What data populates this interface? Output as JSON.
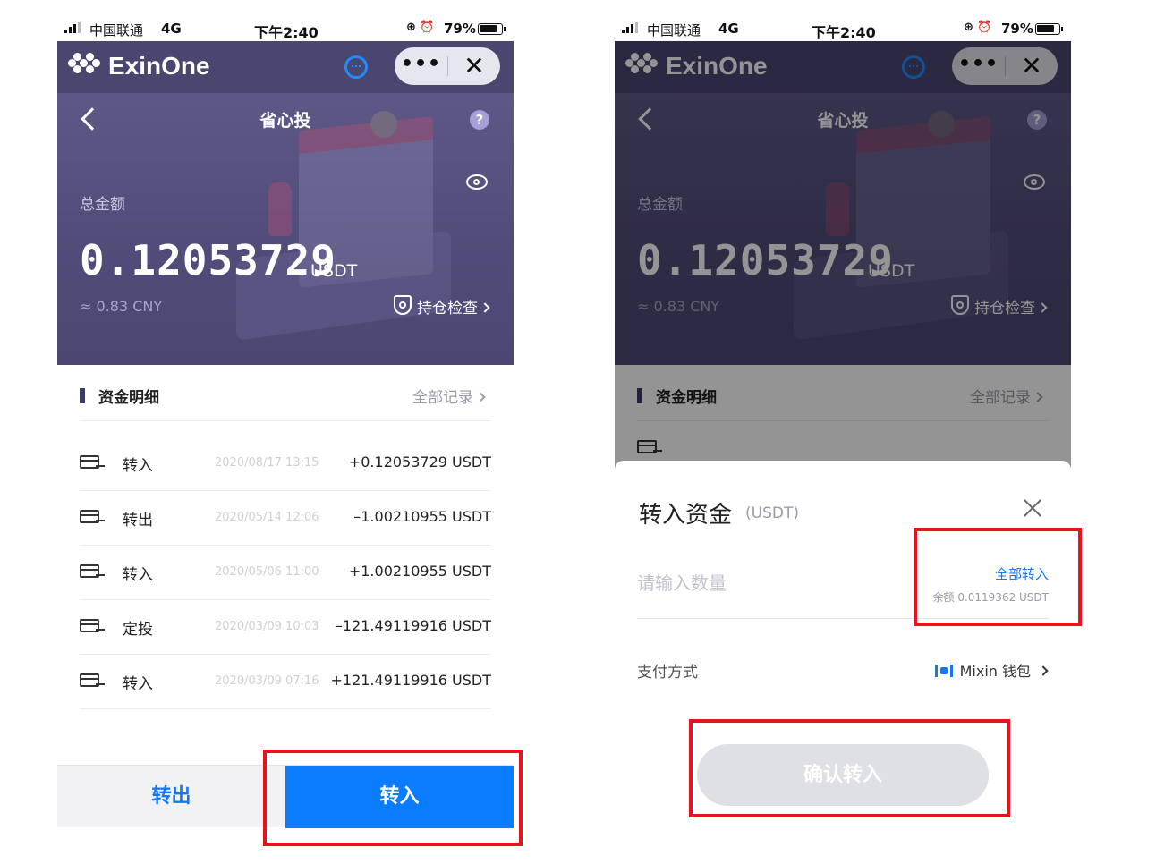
{
  "status": {
    "carrier": "中国联通",
    "network": "4G",
    "time": "下午2:40",
    "battery": "79%",
    "battery_level": 0.79
  },
  "app": {
    "brand": "ExinOne",
    "more_label": "•••",
    "close_label": "✕"
  },
  "page": {
    "title": "省心投",
    "help_label": "?",
    "total_label": "总金额",
    "total_value": "0.12053729",
    "total_unit": "USDT",
    "cny_value": "≈ 0.83 CNY",
    "check_label": "持仓检查"
  },
  "details": {
    "title": "资金明细",
    "all_records": "全部记录",
    "rows": [
      {
        "type": "转入",
        "date": "2020/08/17 13:15",
        "amount": "+0.12053729 USDT"
      },
      {
        "type": "转出",
        "date": "2020/05/14 12:06",
        "amount": "–1.00210955 USDT"
      },
      {
        "type": "转入",
        "date": "2020/05/06 11:00",
        "amount": "+1.00210955 USDT"
      },
      {
        "type": "定投",
        "date": "2020/03/09 10:03",
        "amount": "–121.49119916 USDT"
      },
      {
        "type": "转入",
        "date": "2020/03/09 07:16",
        "amount": "+121.49119916 USDT"
      }
    ]
  },
  "actions": {
    "transfer_out": "转出",
    "transfer_in": "转入"
  },
  "modal": {
    "title": "转入资金",
    "unit": "(USDT)",
    "amount_placeholder": "请输入数量",
    "all_in": "全部转入",
    "balance": "余额 0.0119362 USDT",
    "pay_label": "支付方式",
    "pay_method": "Mixin 钱包",
    "confirm": "确认转入"
  },
  "colors": {
    "header_bg": "#4a4670",
    "primary_blue": "#0a7cff",
    "highlight_red": "#e8141b"
  }
}
